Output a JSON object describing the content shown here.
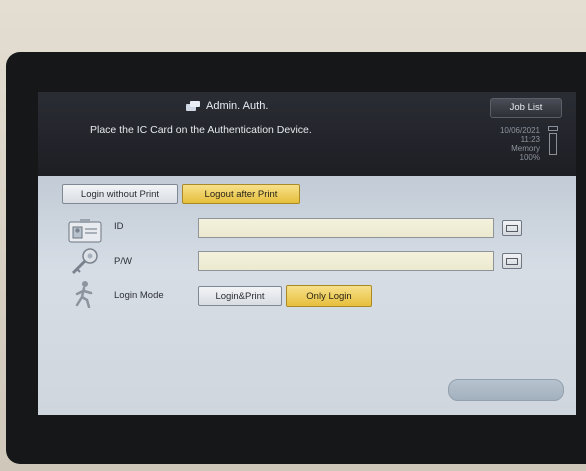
{
  "header": {
    "title": "Admin. Auth.",
    "message": "Place the IC Card on the Authentication Device.",
    "job_list_label": "Job List",
    "date": "10/06/2021",
    "time": "11:23",
    "memory_label": "Memory",
    "memory_value": "100%"
  },
  "auth_mode": {
    "login_without_print": "Login without Print",
    "logout_after_print": "Logout after Print",
    "selected": "Logout after Print"
  },
  "fields": {
    "id_label": "ID",
    "id_value": "",
    "pw_label": "P/W",
    "pw_value": ""
  },
  "login_mode": {
    "label": "Login Mode",
    "options": [
      "Login&Print",
      "Only Login"
    ],
    "selected": "Only Login"
  },
  "ok_button_label": "",
  "colors": {
    "selected_button": "#e6bf3c",
    "header_bg": "#1c1e24",
    "input_bg": "#f4f2dc"
  },
  "icons": {
    "title": "user-device-icon",
    "id": "id-card-icon",
    "pw": "key-icon",
    "login_mode": "person-walking-icon",
    "keyboard": "keyboard-icon",
    "memory": "memory-gauge-icon"
  }
}
